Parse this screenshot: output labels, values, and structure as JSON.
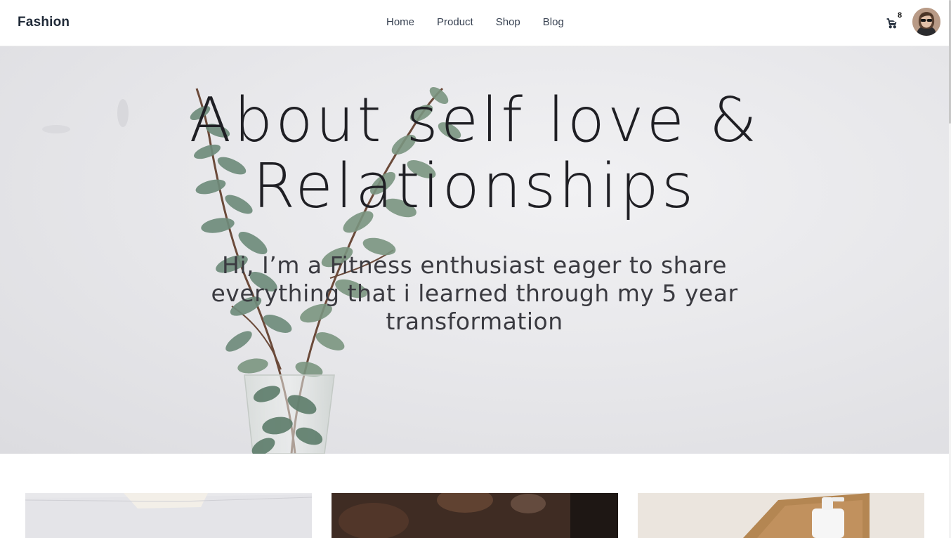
{
  "brand": "Fashion",
  "nav": {
    "items": [
      "Home",
      "Product",
      "Shop",
      "Blog"
    ]
  },
  "cart": {
    "icon": "cart-icon",
    "count": "8"
  },
  "avatar": {
    "icon": "user-avatar"
  },
  "hero": {
    "title_line1": "About self love &",
    "title_line2": "Relationships",
    "subtitle": "Hi, I’m a Fitness enthusiast eager to share everything that i learned through my 5 year transformation"
  },
  "cards": [
    {
      "image": "book-pages-photo"
    },
    {
      "image": "brown-interior-photo"
    },
    {
      "image": "soap-dispenser-photo"
    }
  ],
  "colors": {
    "text_dark": "#1f2937",
    "hero_bg": "#e8e8eb",
    "plant_green": "#6f8a78"
  }
}
